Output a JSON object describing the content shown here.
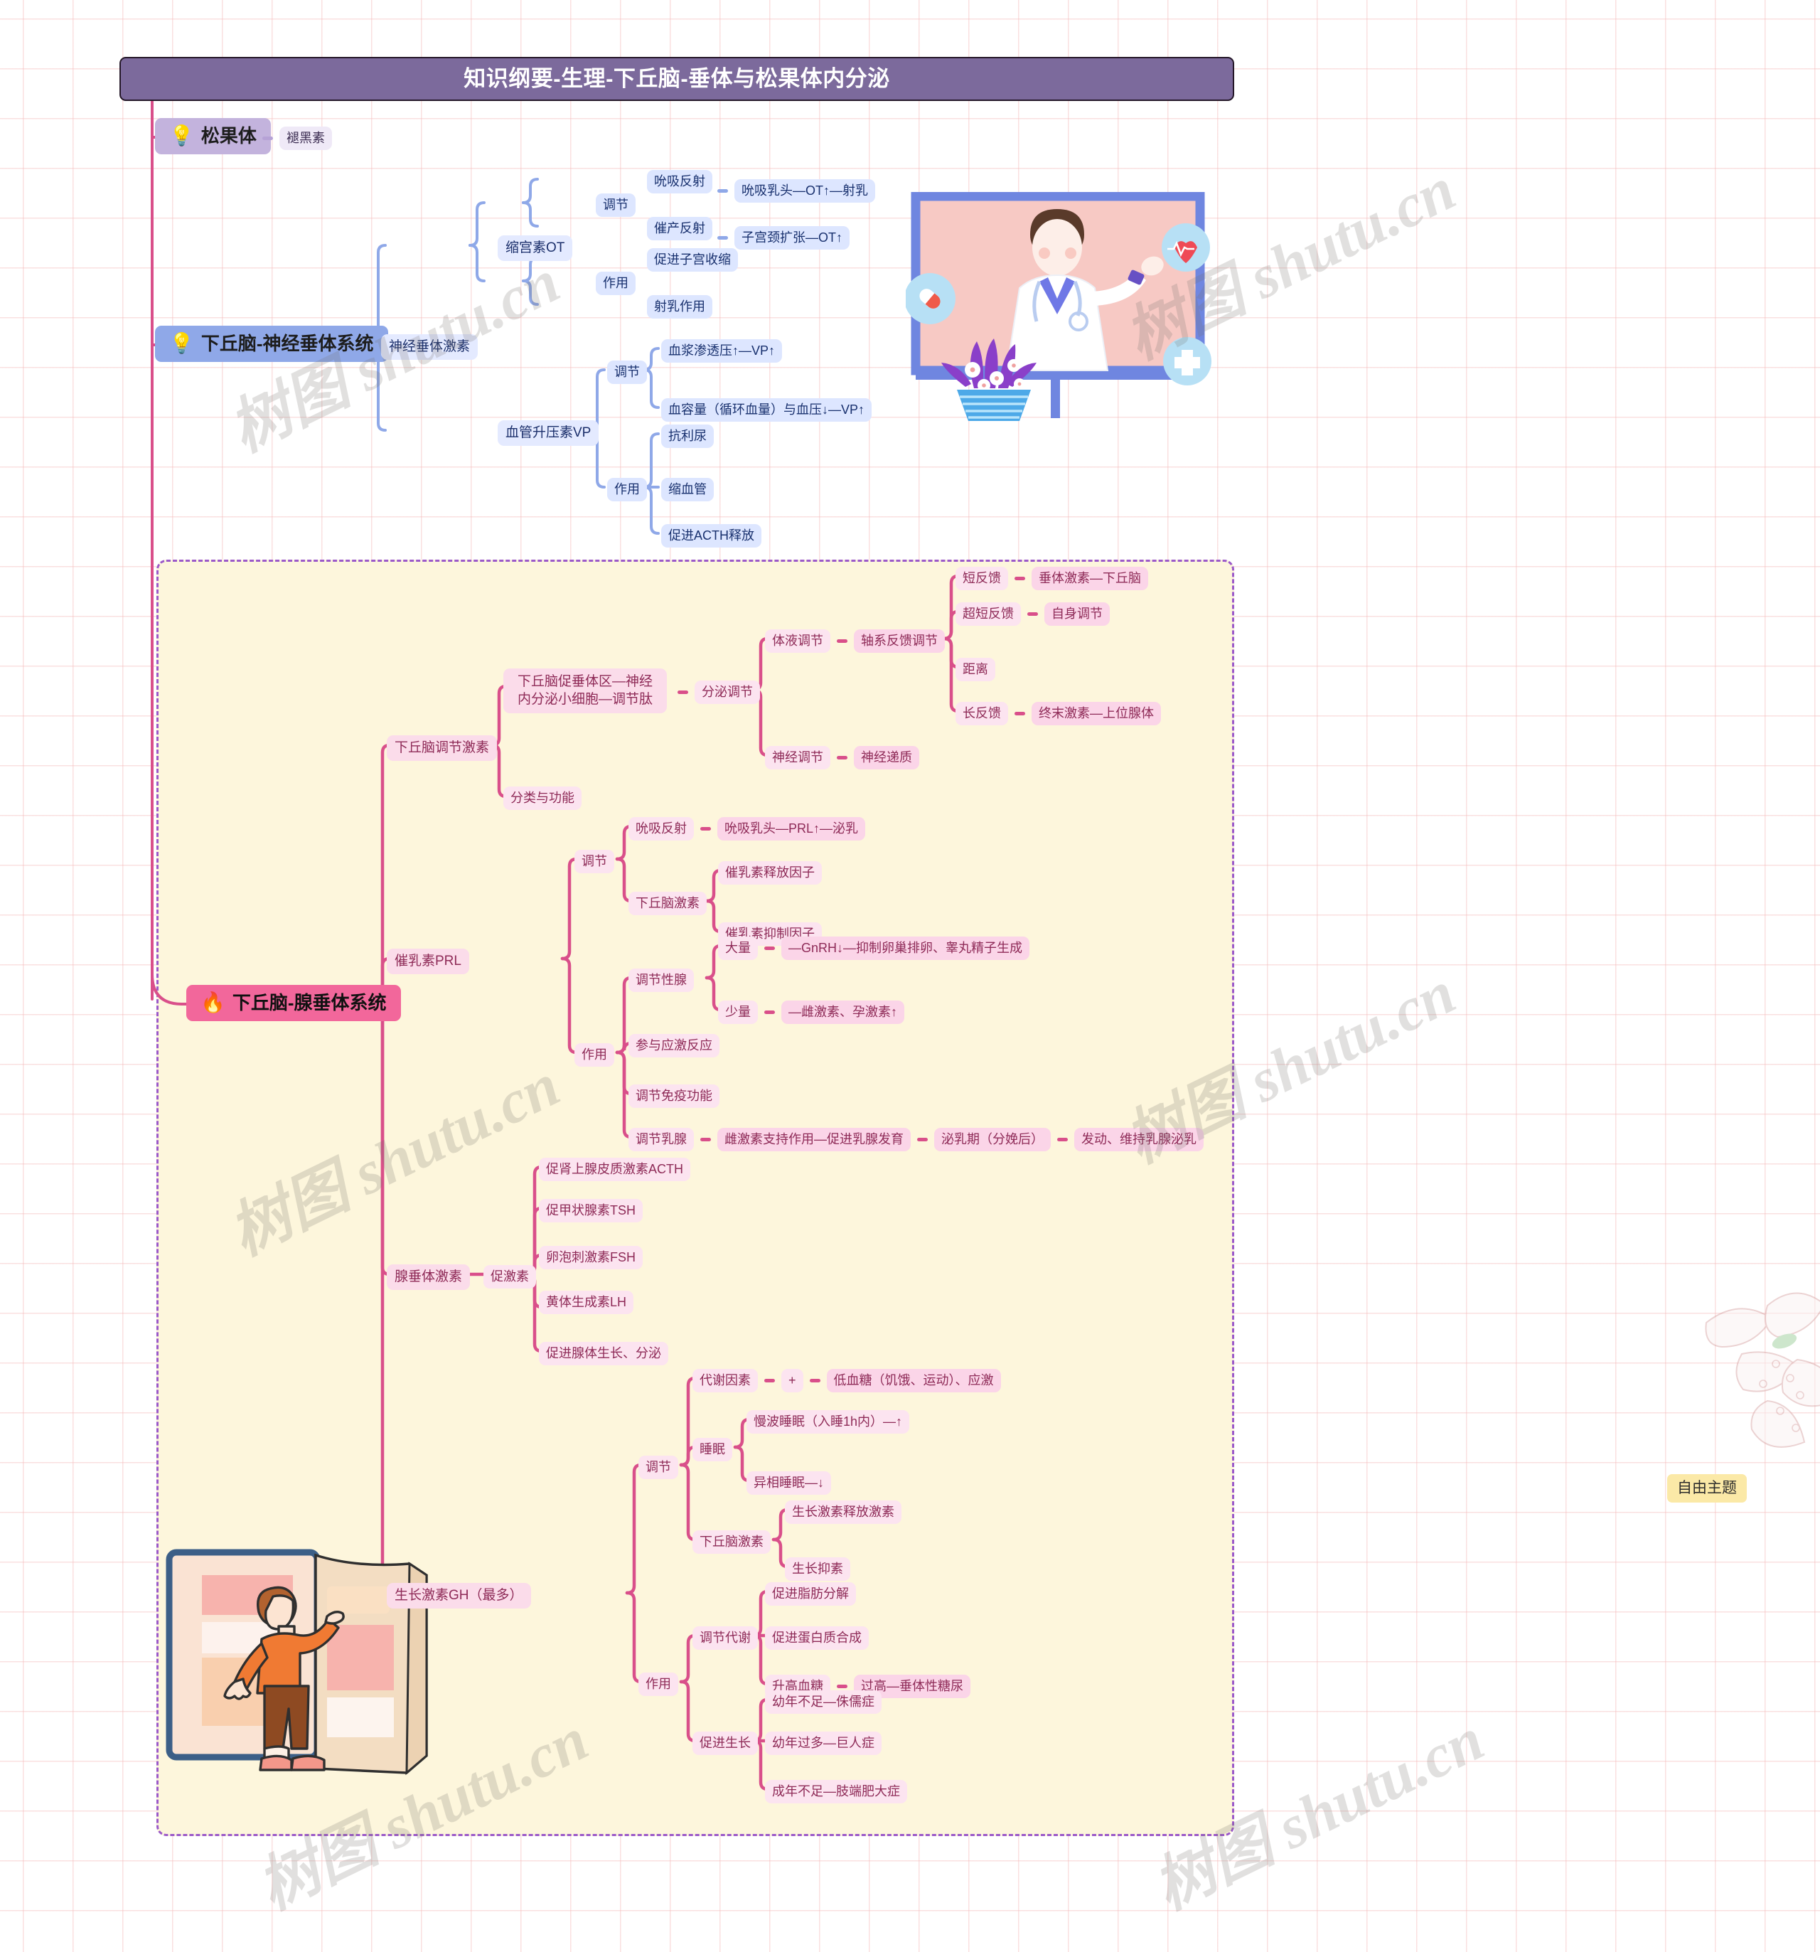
{
  "root": {
    "title": "知识纲要-生理-下丘脑-垂体与松果体内分泌"
  },
  "free_topic": {
    "label": "自由主题"
  },
  "branches": {
    "pineal": {
      "label": "松果体",
      "icon": "lightbulb-icon",
      "child": "褪黑素"
    },
    "neurohypophysis": {
      "label": "下丘脑-神经垂体系统",
      "icon": "lightbulb-icon",
      "hormones_label": "神经垂体激素",
      "ot": {
        "label": "缩宫素OT",
        "regulation_label": "调节",
        "regulation": [
          {
            "label": "吮吸反射",
            "detail": "吮吸乳头—OT↑—射乳"
          },
          {
            "label": "催产反射",
            "detail": "子宫颈扩张—OT↑"
          }
        ],
        "effect_label": "作用",
        "effects": [
          "促进子宫收缩",
          "射乳作用"
        ]
      },
      "vp": {
        "label": "血管升压素VP",
        "regulation_label": "调节",
        "regulation": [
          "血浆渗透压↑—VP↑",
          "血容量（循环血量）与血压↓—VP↑"
        ],
        "effect_label": "作用",
        "effects": [
          "抗利尿",
          "缩血管",
          "促进ACTH释放"
        ]
      }
    },
    "adenohypophysis": {
      "label": "下丘脑-腺垂体系统",
      "icon": "fire-icon",
      "hypo_hormones": {
        "label": "下丘脑调节激素",
        "origin": "下丘脑促垂体区—神经内分泌小细胞—调节肽",
        "secretion_label": "分泌调节",
        "humoral": {
          "label": "体液调节",
          "detail": "轴系反馈调节",
          "items": [
            {
              "label": "短反馈",
              "detail": "垂体激素—下丘脑"
            },
            {
              "label": "超短反馈",
              "detail": "自身调节"
            },
            {
              "label": "距离",
              "detail": ""
            },
            {
              "label": "长反馈",
              "detail": "终末激素—上位腺体"
            }
          ]
        },
        "neural": {
          "label": "神经调节",
          "detail": "神经递质"
        },
        "classification": "分类与功能"
      },
      "prl": {
        "label": "催乳素PRL",
        "regulation_label": "调节",
        "suck_reflex": {
          "label": "吮吸反射",
          "detail": "吮吸乳头—PRL↑—泌乳"
        },
        "hypo_hormone_label": "下丘脑激素",
        "hypo_hormones": [
          "催乳素释放因子",
          "催乳素抑制因子"
        ],
        "effect_label": "作用",
        "gonad_label": "调节性腺",
        "gonad": [
          {
            "label": "大量",
            "detail": "—GnRH↓—抑制卵巢排卵、睾丸精子生成"
          },
          {
            "label": "少量",
            "detail": "—雌激素、孕激素↑"
          }
        ],
        "effects": [
          "参与应激反应",
          "调节免疫功能"
        ],
        "mammary": {
          "label": "调节乳腺",
          "chain": [
            "雌激素支持作用—促进乳腺发育",
            "泌乳期（分娩后）",
            "发动、维持乳腺泌乳"
          ]
        }
      },
      "pituitary_hormones": {
        "label": "腺垂体激素",
        "tropic_label": "促激素",
        "tropic": [
          "促肾上腺皮质激素ACTH",
          "促甲状腺素TSH",
          "卵泡刺激素FSH",
          "黄体生成素LH",
          "促进腺体生长、分泌"
        ]
      },
      "gh": {
        "label": "生长激素GH（最多）",
        "regulation_label": "调节",
        "metabolic_factor": {
          "label": "代谢因素",
          "op": "+",
          "detail": "低血糖（饥饿、运动）、应激"
        },
        "sleep_label": "睡眠",
        "sleep": [
          "慢波睡眠（入睡1h内）—↑",
          "异相睡眠—↓"
        ],
        "hypo_hormone_label": "下丘脑激素",
        "hypo_hormones": [
          "生长激素释放激素",
          "生长抑素"
        ],
        "effect_label": "作用",
        "metabolism_label": "调节代谢",
        "metabolism": [
          {
            "label": "促进脂肪分解",
            "detail": ""
          },
          {
            "label": "促进蛋白质合成",
            "detail": ""
          },
          {
            "label": "升高血糖",
            "detail": "过高—垂体性糖尿"
          }
        ],
        "growth_label": "促进生长",
        "growth": [
          "幼年不足—侏儒症",
          "幼年过多—巨人症",
          "成年不足—肢端肥大症"
        ]
      }
    }
  },
  "watermarks": [
    "树图 shutu.cn",
    "树图 shutu.cn",
    "树图 shutu.cn",
    "树图 shutu.cn",
    "树图 shutu.cn",
    "树图 shutu.cn"
  ]
}
